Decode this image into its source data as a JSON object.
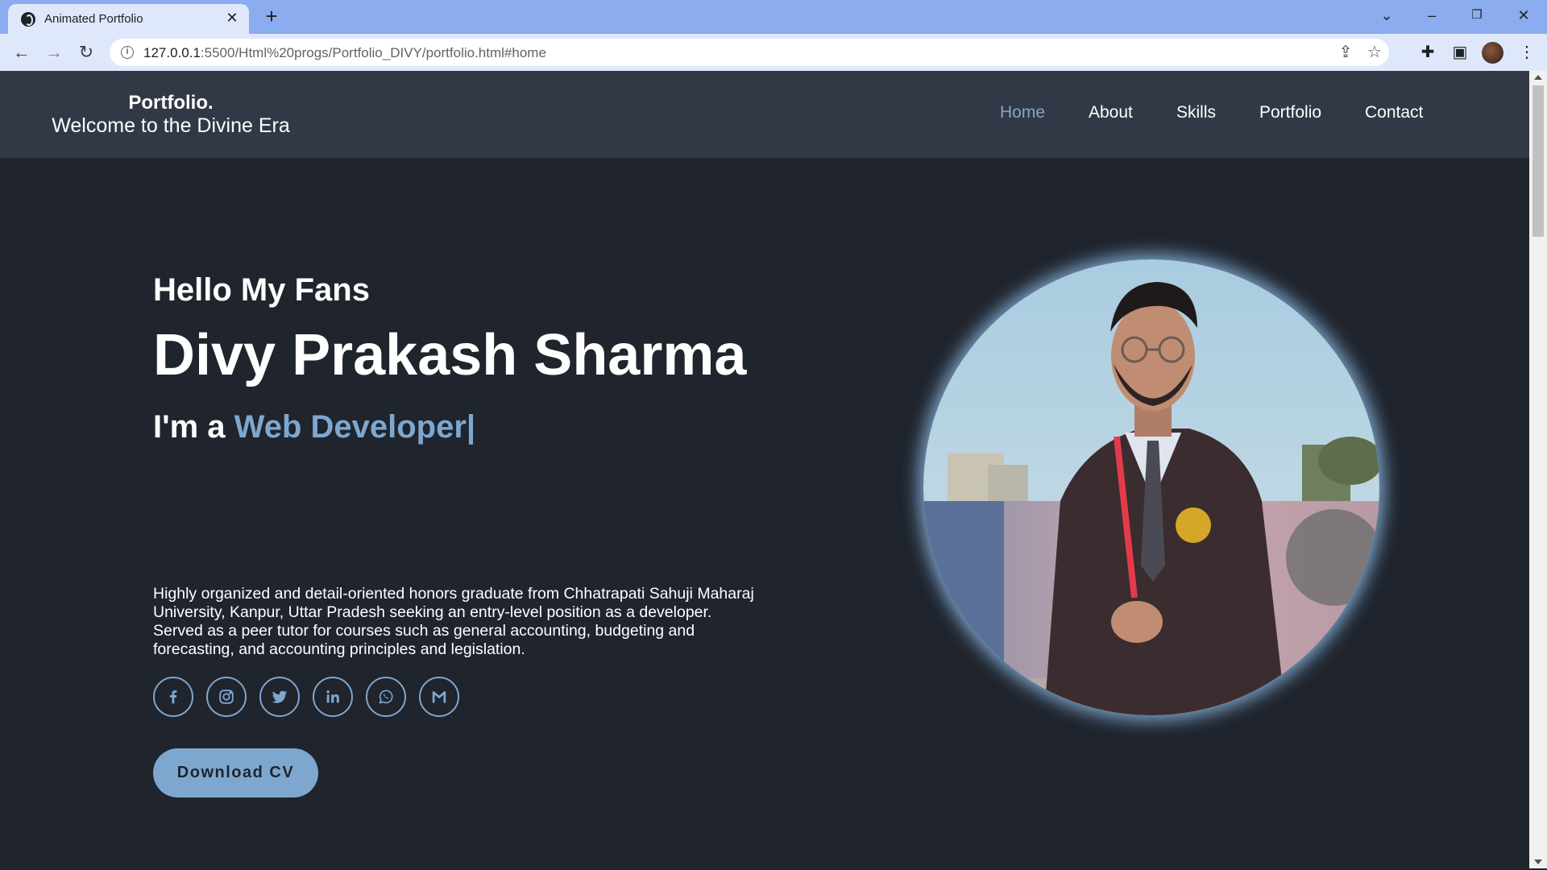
{
  "browser": {
    "tab_title": "Animated Portfolio",
    "url_host": "127.0.0.1",
    "url_rest": ":5500/Html%20progs/Portfolio_DIVY/portfolio.html#home"
  },
  "header": {
    "logo_title": "Portfolio.",
    "logo_subtitle": "Welcome to the Divine Era",
    "nav": [
      {
        "label": "Home",
        "active": true
      },
      {
        "label": "About",
        "active": false
      },
      {
        "label": "Skills",
        "active": false
      },
      {
        "label": "Portfolio",
        "active": false
      },
      {
        "label": "Contact",
        "active": false
      }
    ]
  },
  "home": {
    "greeting": "Hello My Fans",
    "name": "Divy Prakash Sharma",
    "role_prefix": "I'm a ",
    "role_highlight": "Web Developer|",
    "bio": "Highly organized and detail-oriented honors graduate from Chhatrapati Sahuji Maharaj University, Kanpur, Uttar Pradesh seeking an entry-level position as a developer. Served as a peer tutor for courses such as general accounting, budgeting and forecasting, and accounting principles and legislation.",
    "socials": [
      "facebook",
      "instagram",
      "twitter",
      "linkedin",
      "whatsapp",
      "gmail"
    ],
    "cta_label": "Download CV"
  },
  "colors": {
    "page_bg": "#1f242d",
    "header_bg": "#323946",
    "accent": "#7ea7cf",
    "tabbar_bg": "#8bacee",
    "toolbar_bg": "#dfe8fb"
  }
}
